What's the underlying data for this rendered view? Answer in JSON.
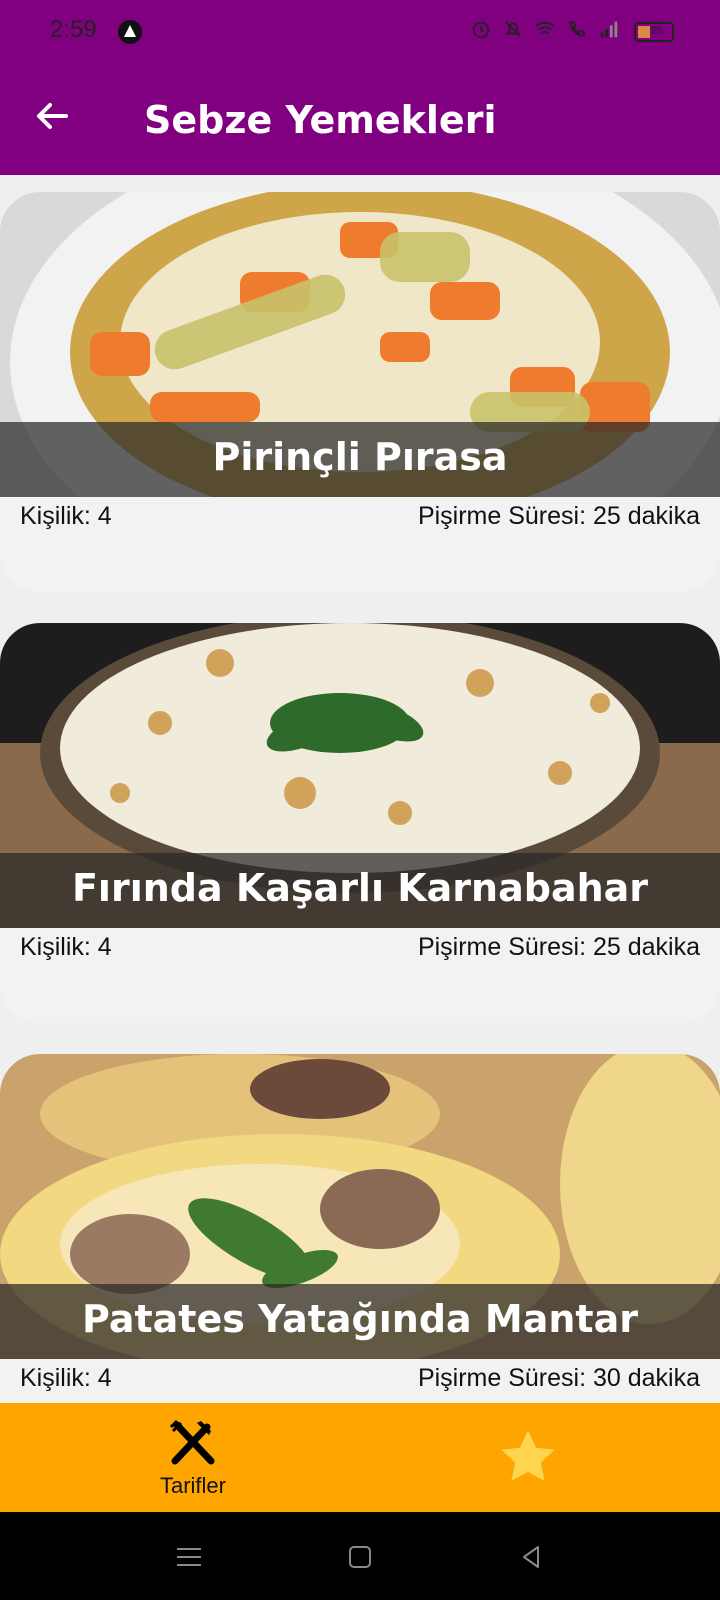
{
  "status_bar": {
    "time": "2:59",
    "battery": "35"
  },
  "app_bar": {
    "title": "Sebze Yemekleri",
    "back_icon": "arrow-left-icon"
  },
  "recipes": [
    {
      "title": "Pirinçli Pırasa",
      "servings": "Kişilik: 4",
      "cook_time": "Pişirme Süresi: 25 dakika"
    },
    {
      "title": "Fırında Kaşarlı Karnabahar",
      "servings": "Kişilik: 4",
      "cook_time": "Pişirme Süresi: 25 dakika"
    },
    {
      "title": "Patates Yatağında Mantar",
      "servings": "Kişilik: 4",
      "cook_time": "Pişirme Süresi: 30 dakika"
    }
  ],
  "bottom_nav": {
    "recipes_label": "Tarifler",
    "recipes_icon": "fork-knife-icon",
    "favorites_icon": "star-icon"
  },
  "colors": {
    "app_bar": "#800080",
    "bottom_nav": "#FFA500",
    "favorite_star": "#FFD54F"
  }
}
